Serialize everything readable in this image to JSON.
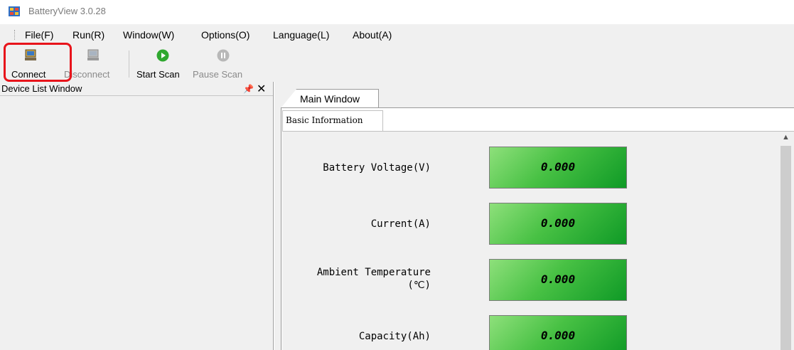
{
  "window": {
    "title": "BatteryView 3.0.28"
  },
  "menu": [
    "File(F)",
    "Run(R)",
    "Window(W)",
    "Options(O)",
    "Language(L)",
    "About(A)"
  ],
  "toolbar": {
    "connect": "Connect",
    "disconnect": "Disconnect",
    "start_scan": "Start Scan",
    "pause_scan": "Pause Scan"
  },
  "device_panel": {
    "title": "Device List Window",
    "pin_icon": "pin-icon",
    "close_icon": "close-icon"
  },
  "main": {
    "tab": "Main Window",
    "subtab": "Basic Information",
    "rows": [
      {
        "label": "Battery Voltage(V)",
        "value": "0.000"
      },
      {
        "label": "Current(A)",
        "value": "0.000"
      },
      {
        "label_line1": "Ambient Temperature",
        "label_line2": "(℃)",
        "value": "0.000"
      },
      {
        "label": "Capacity(Ah)",
        "value": "0.000"
      }
    ]
  },
  "colors": {
    "highlight": "#e8141b",
    "value_green": "#48c144",
    "start_icon": "#2fa82f"
  }
}
